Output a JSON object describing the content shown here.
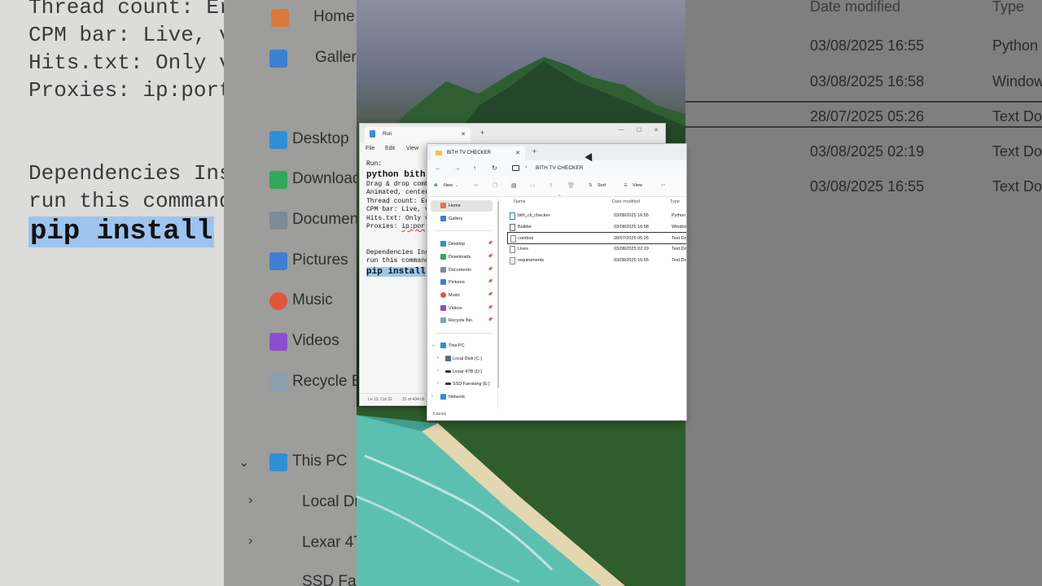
{
  "bg_notepad": {
    "lines": [
      "Thread count: Er",
      "CPM bar: Live, v",
      "Hits.txt: Only v",
      "Proxies: ip:port",
      "Dependencies Ins",
      "run this command",
      "pip install"
    ]
  },
  "bg_nav": {
    "items": [
      "Home",
      "Gallery",
      "Desktop",
      "Download",
      "Documen",
      "Pictures",
      "Music",
      "Videos",
      "Recycle B",
      "This PC",
      "Local Dr",
      "Lexar 4T",
      "SSD Fan"
    ]
  },
  "bg_files": {
    "headers": [
      "Date modified",
      "Type"
    ],
    "rows": [
      {
        "date": "03/08/2025 16:55",
        "type": "Python"
      },
      {
        "date": "03/08/2025 16:58",
        "type": "Window"
      },
      {
        "date": "28/07/2025 05:26",
        "type": "Text Do"
      },
      {
        "date": "03/08/2025 02:19",
        "type": "Text Do"
      },
      {
        "date": "03/08/2025 16:55",
        "type": "Text Do"
      }
    ]
  },
  "notepad": {
    "tab_title": "Run",
    "menu": [
      "File",
      "Edit",
      "View"
    ],
    "lines": {
      "l1": "Run:",
      "l2": "python bith",
      "l3": "Drag & drop comb",
      "l4": "Animated, center",
      "l5": "Thread count: Er",
      "l6": "CPM bar: Live, v",
      "l7": "Hits.txt: Only v",
      "l8a": "Proxies: ",
      "l8b": "ip:por",
      "l9": "Dependencies Ins",
      "l10": "run this command",
      "l11": "pip install"
    },
    "status": {
      "position": "Ln 13, Col 32",
      "chars": "31 of 434 ch"
    }
  },
  "explorer": {
    "tab_title": "BITH TV CHECKER",
    "breadcrumb": "BITH TV CHECKER",
    "commands": {
      "new": "New",
      "sort": "Sort",
      "view": "View",
      "more": "···"
    },
    "sidebar": {
      "home": "Home",
      "gallery": "Gallery",
      "quick": [
        {
          "label": "Desktop",
          "color": "#2e8fd6"
        },
        {
          "label": "Downloads",
          "color": "#2fa85a"
        },
        {
          "label": "Documents",
          "color": "#7d8a98"
        },
        {
          "label": "Pictures",
          "color": "#3d7fd0"
        },
        {
          "label": "Music",
          "color": "#e0553b"
        },
        {
          "label": "Videos",
          "color": "#8a4fd0"
        },
        {
          "label": "Recycle Bin",
          "color": "#8aa0b0"
        }
      ],
      "this_pc": "This PC",
      "drives": [
        "Local Disk (C:)",
        "Lexar 4TB (D:)",
        "SSD Fanxiang (E:)"
      ],
      "network": "Network"
    },
    "columns": {
      "name": "Name",
      "date": "Date modified",
      "type": "Type"
    },
    "files": [
      {
        "name": "bith_cli_checker",
        "date": "03/08/2025 16:55",
        "type": "Python"
      },
      {
        "name": "Builder",
        "date": "03/08/2025 16:58",
        "type": "Window"
      },
      {
        "name": "combos",
        "date": "28/07/2025 05:26",
        "type": "Text Do"
      },
      {
        "name": "Lives",
        "date": "03/08/2025 02:19",
        "type": "Text Do"
      },
      {
        "name": "requirements",
        "date": "03/08/2025 16:55",
        "type": "Text Do"
      }
    ],
    "status": "5 items"
  }
}
